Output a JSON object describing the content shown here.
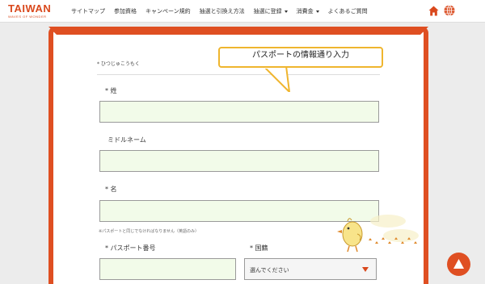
{
  "brand": {
    "name": "TAIWAN",
    "tagline": "WAVES OF WONDER",
    "color": "#d9481c"
  },
  "nav": {
    "items": [
      {
        "label": "サイトマップ",
        "has_dropdown": false
      },
      {
        "label": "参加資格",
        "has_dropdown": false
      },
      {
        "label": "キャンペーン規約",
        "has_dropdown": false
      },
      {
        "label": "抽選と引換え方法",
        "has_dropdown": false
      },
      {
        "label": "抽選に登録",
        "has_dropdown": true
      },
      {
        "label": "消費金",
        "has_dropdown": true
      },
      {
        "label": "よくあるご質問",
        "has_dropdown": false
      }
    ],
    "icons": [
      "home-icon",
      "globe-icon"
    ]
  },
  "form": {
    "section_label": "* ひつじゅこうもく",
    "fields": {
      "surname_label": "* 姓",
      "surname_value": "",
      "middle_name_label": "ミドルネーム",
      "middle_name_value": "",
      "given_name_label": "* 名",
      "given_name_value": "",
      "passport_number_label": "* パスポート番号",
      "passport_number_value": "",
      "nationality_label": "* 国籍",
      "nationality_selected": "選んでください"
    },
    "note": "※パスポートと同じでなければなりません（英語のみ）",
    "accent_color": "#df4f22",
    "field_bg": "#f2fbe9"
  },
  "callout": {
    "text": "パスポートの情報通り入力",
    "border_color": "#efb52e"
  },
  "back_to_top": {
    "icon": "arrow-up-icon",
    "color": "#df4f22"
  }
}
